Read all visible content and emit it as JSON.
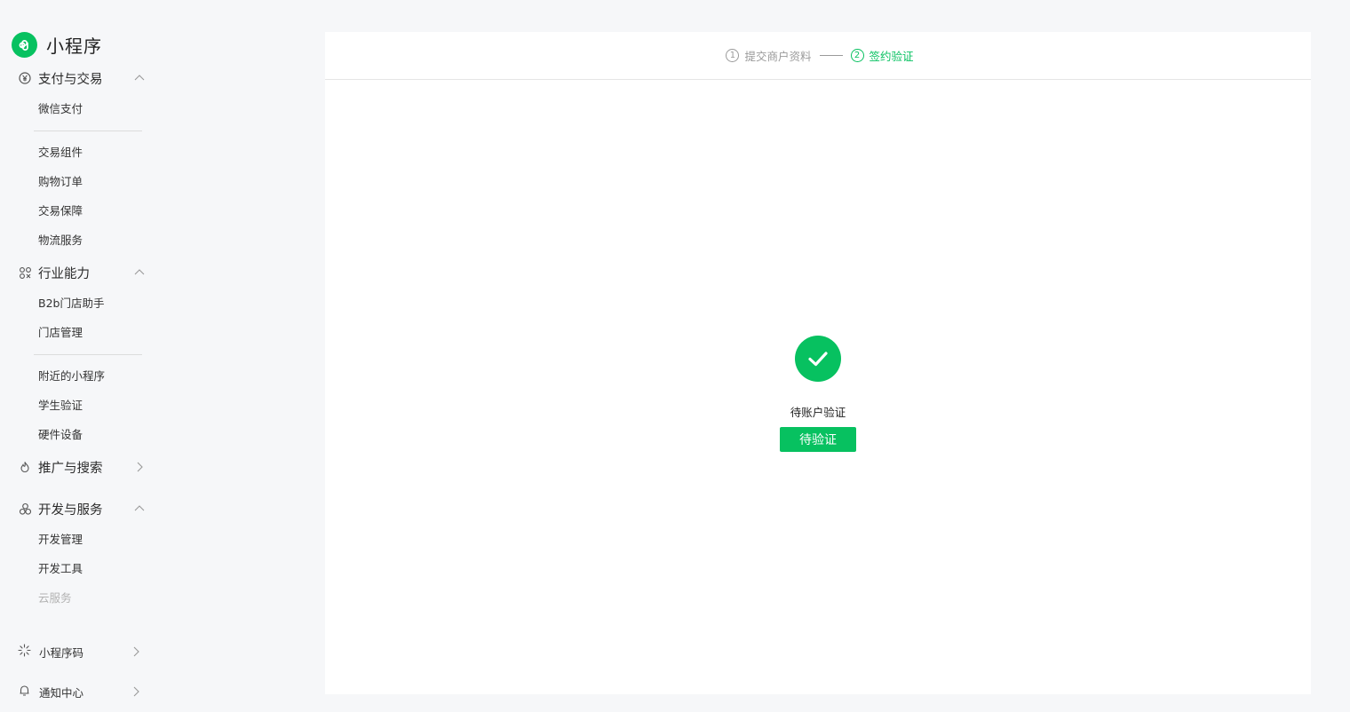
{
  "brand": {
    "name": "小程序",
    "color": "#07c160"
  },
  "sidebar": {
    "groups": [
      {
        "label": "支付与交易",
        "icon": "yen-circle-icon",
        "expanded": true,
        "items": [
          "微信支付",
          "交易组件",
          "购物订单",
          "交易保障",
          "物流服务"
        ]
      },
      {
        "label": "行业能力",
        "icon": "industry-icon",
        "expanded": true,
        "items": [
          "B2b门店助手",
          "门店管理",
          "附近的小程序",
          "学生验证",
          "硬件设备"
        ]
      },
      {
        "label": "推广与搜索",
        "icon": "flame-icon",
        "expanded": false,
        "items": []
      },
      {
        "label": "开发与服务",
        "icon": "clover-icon",
        "expanded": true,
        "items": [
          "开发管理",
          "开发工具",
          "云服务"
        ]
      }
    ],
    "footer": [
      {
        "label": "小程序码",
        "icon": "sunburst-icon"
      },
      {
        "label": "通知中心",
        "icon": "bell-icon"
      }
    ]
  },
  "steps": [
    {
      "num": "1",
      "label": "提交商户资料",
      "state": "done"
    },
    {
      "num": "2",
      "label": "签约验证",
      "state": "active"
    }
  ],
  "result": {
    "title": "待账户验证",
    "button_label": "待验证"
  }
}
